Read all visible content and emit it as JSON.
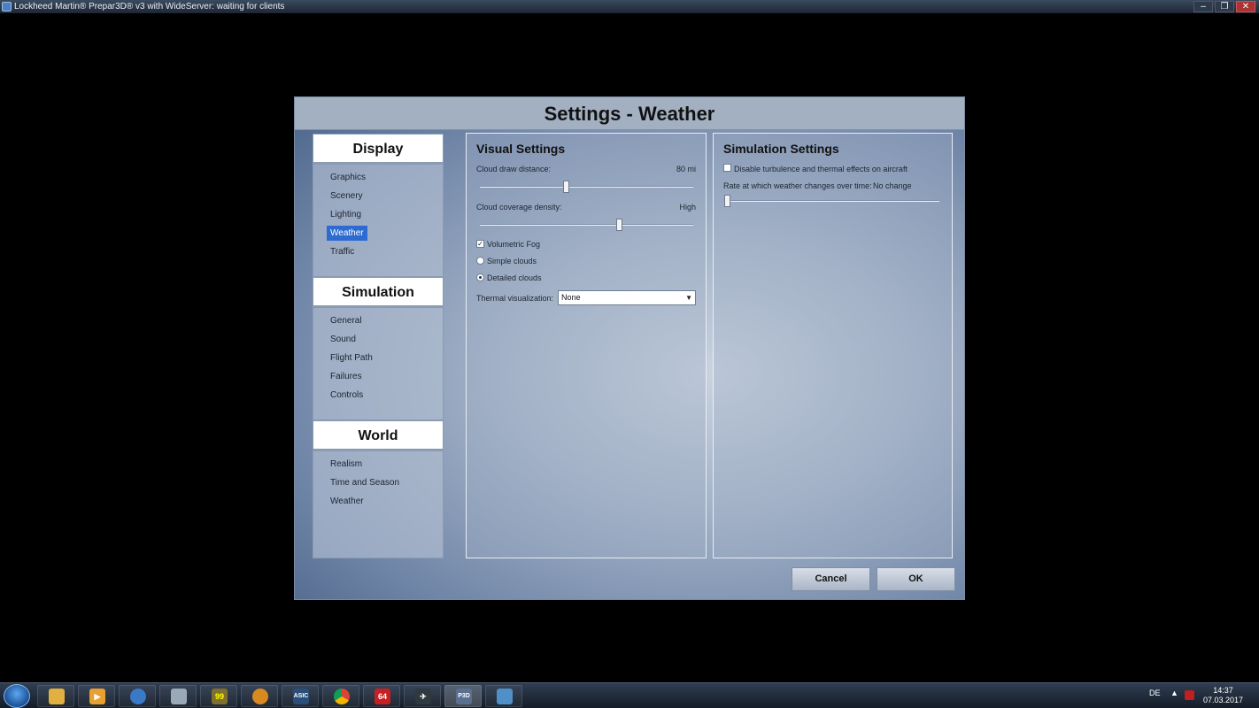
{
  "window": {
    "title": "Lockheed Martin® Prepar3D® v3 with WideServer: waiting for clients",
    "minimize": "–",
    "maximize": "❐",
    "close": "✕"
  },
  "dialog": {
    "title": "Settings - Weather"
  },
  "nav": {
    "sections": [
      {
        "header": "Display",
        "items": [
          "Graphics",
          "Scenery",
          "Lighting",
          "Weather",
          "Traffic"
        ],
        "active": "Weather"
      },
      {
        "header": "Simulation",
        "items": [
          "General",
          "Sound",
          "Flight Path",
          "Failures",
          "Controls"
        ]
      },
      {
        "header": "World",
        "items": [
          "Realism",
          "Time and Season",
          "Weather"
        ]
      }
    ]
  },
  "visual": {
    "title": "Visual Settings",
    "cloud_draw_label": "Cloud draw distance:",
    "cloud_draw_value": "80 mi",
    "cloud_draw_level": 0.4,
    "cloud_density_label": "Cloud coverage density:",
    "cloud_density_value": "High",
    "cloud_density_level": 0.66,
    "volumetric_fog_label": "Volumetric Fog",
    "volumetric_fog_checked": true,
    "simple_clouds_label": "Simple clouds",
    "detailed_clouds_label": "Detailed clouds",
    "cloud_detail_selected": "Detailed clouds",
    "thermal_label": "Thermal visualization:",
    "thermal_value": "None"
  },
  "simulation": {
    "title": "Simulation Settings",
    "disable_turbulence_label": "Disable turbulence and thermal effects on aircraft",
    "disable_turbulence_checked": false,
    "rate_label": "Rate at which weather changes over time:",
    "rate_value": "No change",
    "rate_level": 0.0
  },
  "buttons": {
    "cancel": "Cancel",
    "ok": "OK"
  },
  "taskbar": {
    "apps": [
      "explorer-icon",
      "media-player-icon",
      "network-icon",
      "calculator-icon",
      "app-99-icon",
      "aircraft-tool-icon",
      "asic-icon",
      "chrome-icon",
      "app-64-icon",
      "fsuipc-icon",
      "p3d-icon",
      "window-app-icon"
    ],
    "app_99_text": "99",
    "asic_text": "ASIC",
    "app_64_text": "64",
    "p3d_text": "P3D",
    "language": "DE",
    "time": "14:37",
    "date": "07.03.2017"
  },
  "colors": {
    "active_item": "#2e6bd1",
    "dialog_header": "#a3b0c2"
  }
}
